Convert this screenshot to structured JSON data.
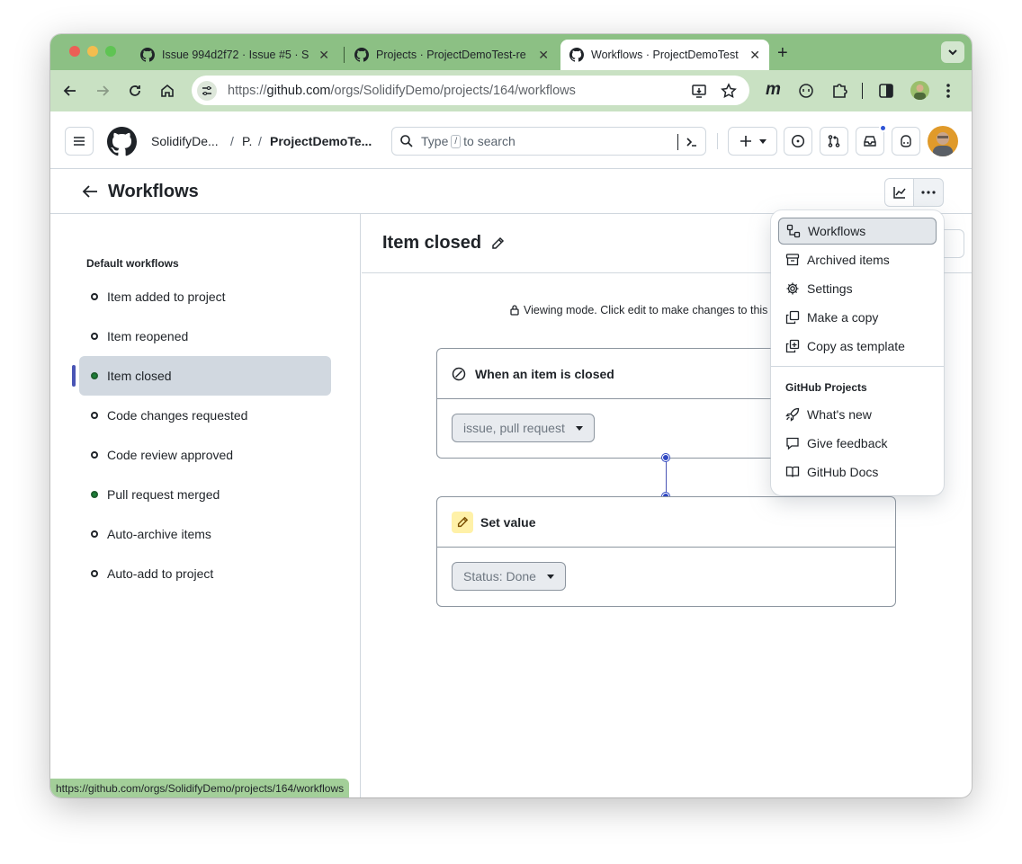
{
  "browser": {
    "tabs": [
      {
        "title": "Issue 994d2f72 · Issue #5 · S"
      },
      {
        "title": "Projects · ProjectDemoTest-re"
      },
      {
        "title": "Workflows · ProjectDemoTest"
      }
    ],
    "url_prefix": "https://",
    "url_host": "github.com",
    "url_path": "/orgs/SolidifyDemo/projects/164/workflows",
    "status_url": "https://github.com/orgs/SolidifyDemo/projects/164/workflows",
    "extension_m": "m"
  },
  "header": {
    "breadcrumb": {
      "org": "SolidifyDe...",
      "mid": "P.",
      "project": "ProjectDemoTe..."
    },
    "search": {
      "prefix": "Type",
      "key": "/",
      "suffix": "to search"
    }
  },
  "page": {
    "title": "Workflows"
  },
  "sidebar": {
    "heading": "Default workflows",
    "items": [
      {
        "label": "Item added to project",
        "enabled": false
      },
      {
        "label": "Item reopened",
        "enabled": false
      },
      {
        "label": "Item closed",
        "enabled": true
      },
      {
        "label": "Code changes requested",
        "enabled": false
      },
      {
        "label": "Code review approved",
        "enabled": false
      },
      {
        "label": "Pull request merged",
        "enabled": true
      },
      {
        "label": "Auto-archive items",
        "enabled": false
      },
      {
        "label": "Auto-add to project",
        "enabled": false
      }
    ]
  },
  "main": {
    "title": "Item closed",
    "viewing_notice": "Viewing mode. Click edit to make changes to this",
    "trigger": {
      "title": "When an item is closed",
      "dropdown": "issue, pull request"
    },
    "action": {
      "title": "Set value",
      "dropdown": "Status: Done"
    }
  },
  "menu": {
    "items": [
      "Workflows",
      "Archived items",
      "Settings",
      "Make a copy",
      "Copy as template"
    ],
    "group_title": "GitHub Projects",
    "group_items": [
      "What's new",
      "Give feedback",
      "GitHub Docs"
    ]
  },
  "colors": {
    "tabstrip": "#8cc084",
    "toolbar": "#c9e1c3",
    "enabled_dot": "#1a7f37",
    "accent": "#4a55b5"
  }
}
